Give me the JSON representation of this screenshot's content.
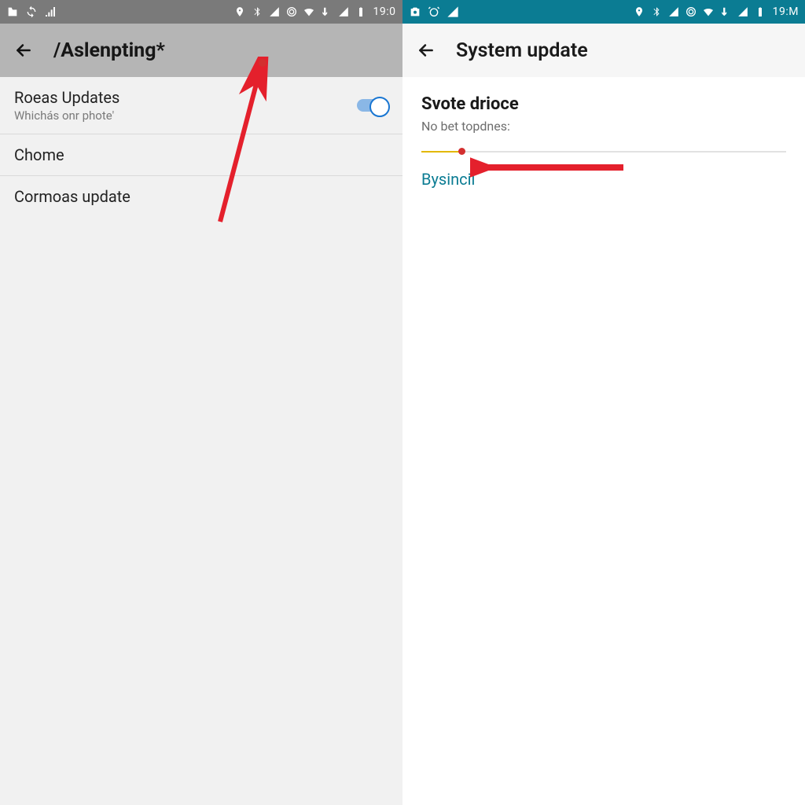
{
  "colors": {
    "status_left_bg": "#7a7a7a",
    "status_right_bg": "#0b7c93",
    "accent_teal": "#0b7c93",
    "arrow_red": "#e4202c",
    "switch_blue": "#1976d2"
  },
  "left": {
    "status": {
      "clock": "19:0\u001a"
    },
    "header": {
      "title": "/Aslenpting*"
    },
    "rows": [
      {
        "id": "roeas-updates",
        "primary": "Roeas Updates",
        "secondary": "Whichás onr phote'",
        "has_toggle": true,
        "toggle_on": true
      },
      {
        "id": "chome",
        "primary": "Chome"
      },
      {
        "id": "cormoas-update",
        "primary": "Cormoas update"
      }
    ]
  },
  "right": {
    "status": {
      "clock": "19:M"
    },
    "header": {
      "title": "System update"
    },
    "section": {
      "title": "Svote drioce",
      "subtitle": "No bet topdnes:"
    },
    "action_link": "Bysinciı"
  }
}
